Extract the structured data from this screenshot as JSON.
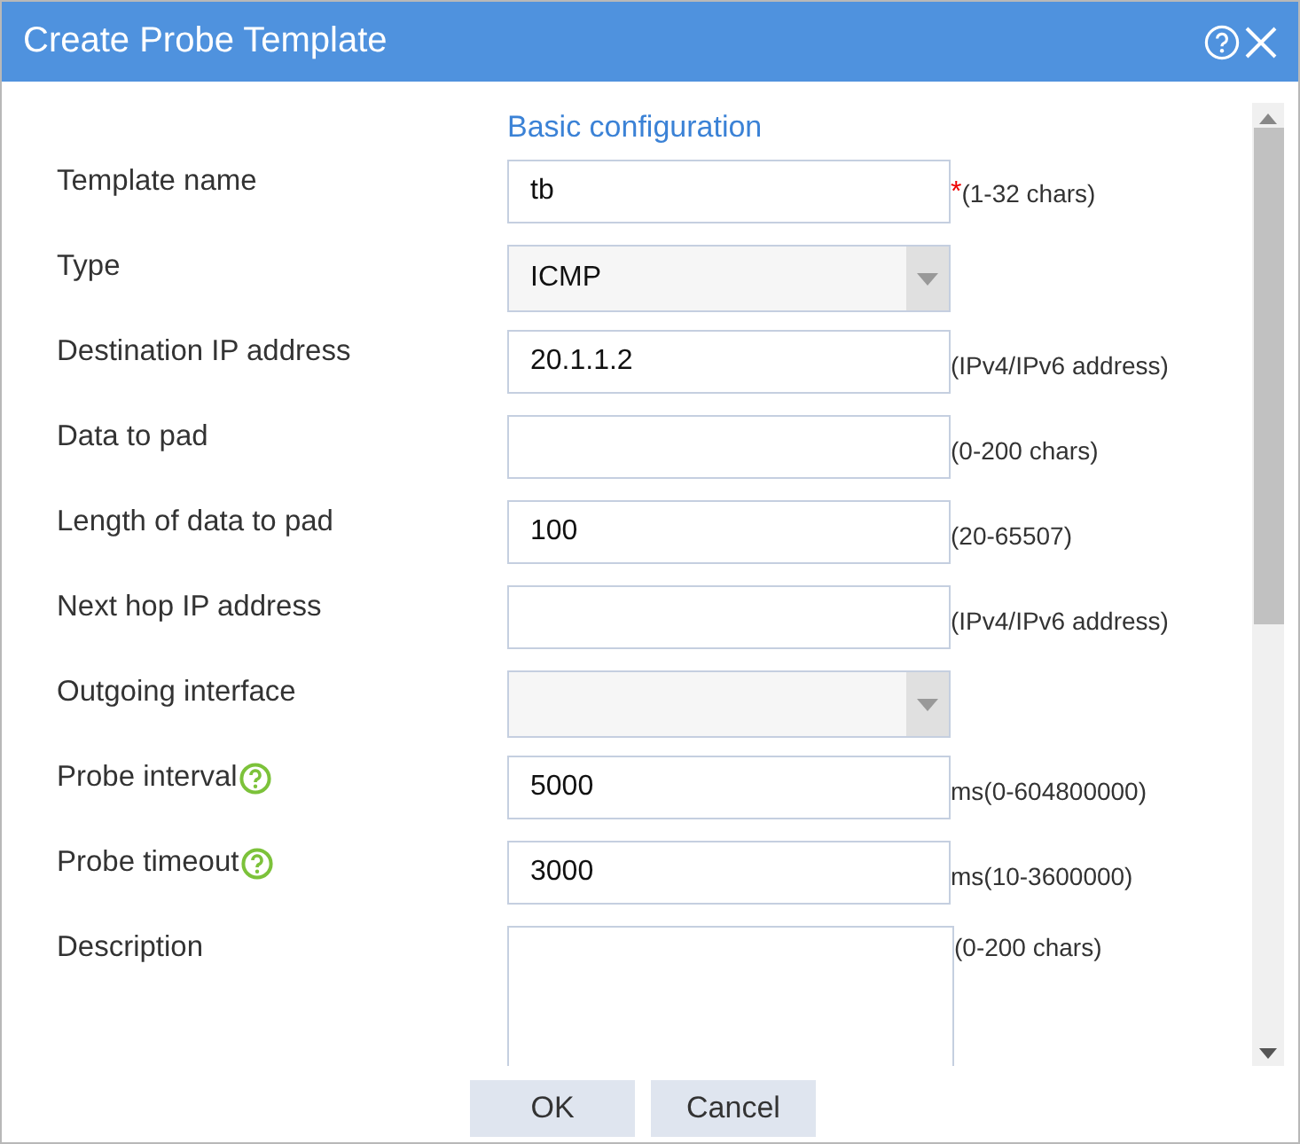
{
  "window": {
    "title": "Create Probe Template"
  },
  "section": "Basic configuration",
  "fields": [
    {
      "kind": "text",
      "label": "Template name",
      "value": "tb",
      "required_mark": "*",
      "help": false,
      "hint": "(1-32 chars)"
    },
    {
      "kind": "select",
      "label": "Type",
      "value": "ICMP",
      "help": false
    },
    {
      "kind": "text",
      "label": "Destination IP address",
      "value": "20.1.1.2",
      "help": false,
      "hint": "(IPv4/IPv6 address)"
    },
    {
      "kind": "text",
      "label": "Data to pad",
      "help": false,
      "hint": "(0-200 chars)"
    },
    {
      "kind": "text",
      "label": "Length of data to pad",
      "value": "100",
      "help": false,
      "hint": "(20-65507)"
    },
    {
      "kind": "text",
      "label": "Next hop IP address",
      "help": false,
      "hint": "(IPv4/IPv6 address)"
    },
    {
      "kind": "select",
      "label": "Outgoing interface",
      "help": false
    },
    {
      "kind": "text",
      "label": "Probe interval",
      "value": "5000",
      "help": true,
      "hint": "ms(0-604800000)"
    },
    {
      "kind": "text",
      "label": "Probe timeout",
      "value": "3000",
      "help": true,
      "hint": "ms(10-3600000)"
    },
    {
      "kind": "textarea",
      "label": "Description",
      "help": false,
      "hint": "(0-200 chars)"
    }
  ],
  "buttons": [
    "OK",
    "Cancel"
  ]
}
